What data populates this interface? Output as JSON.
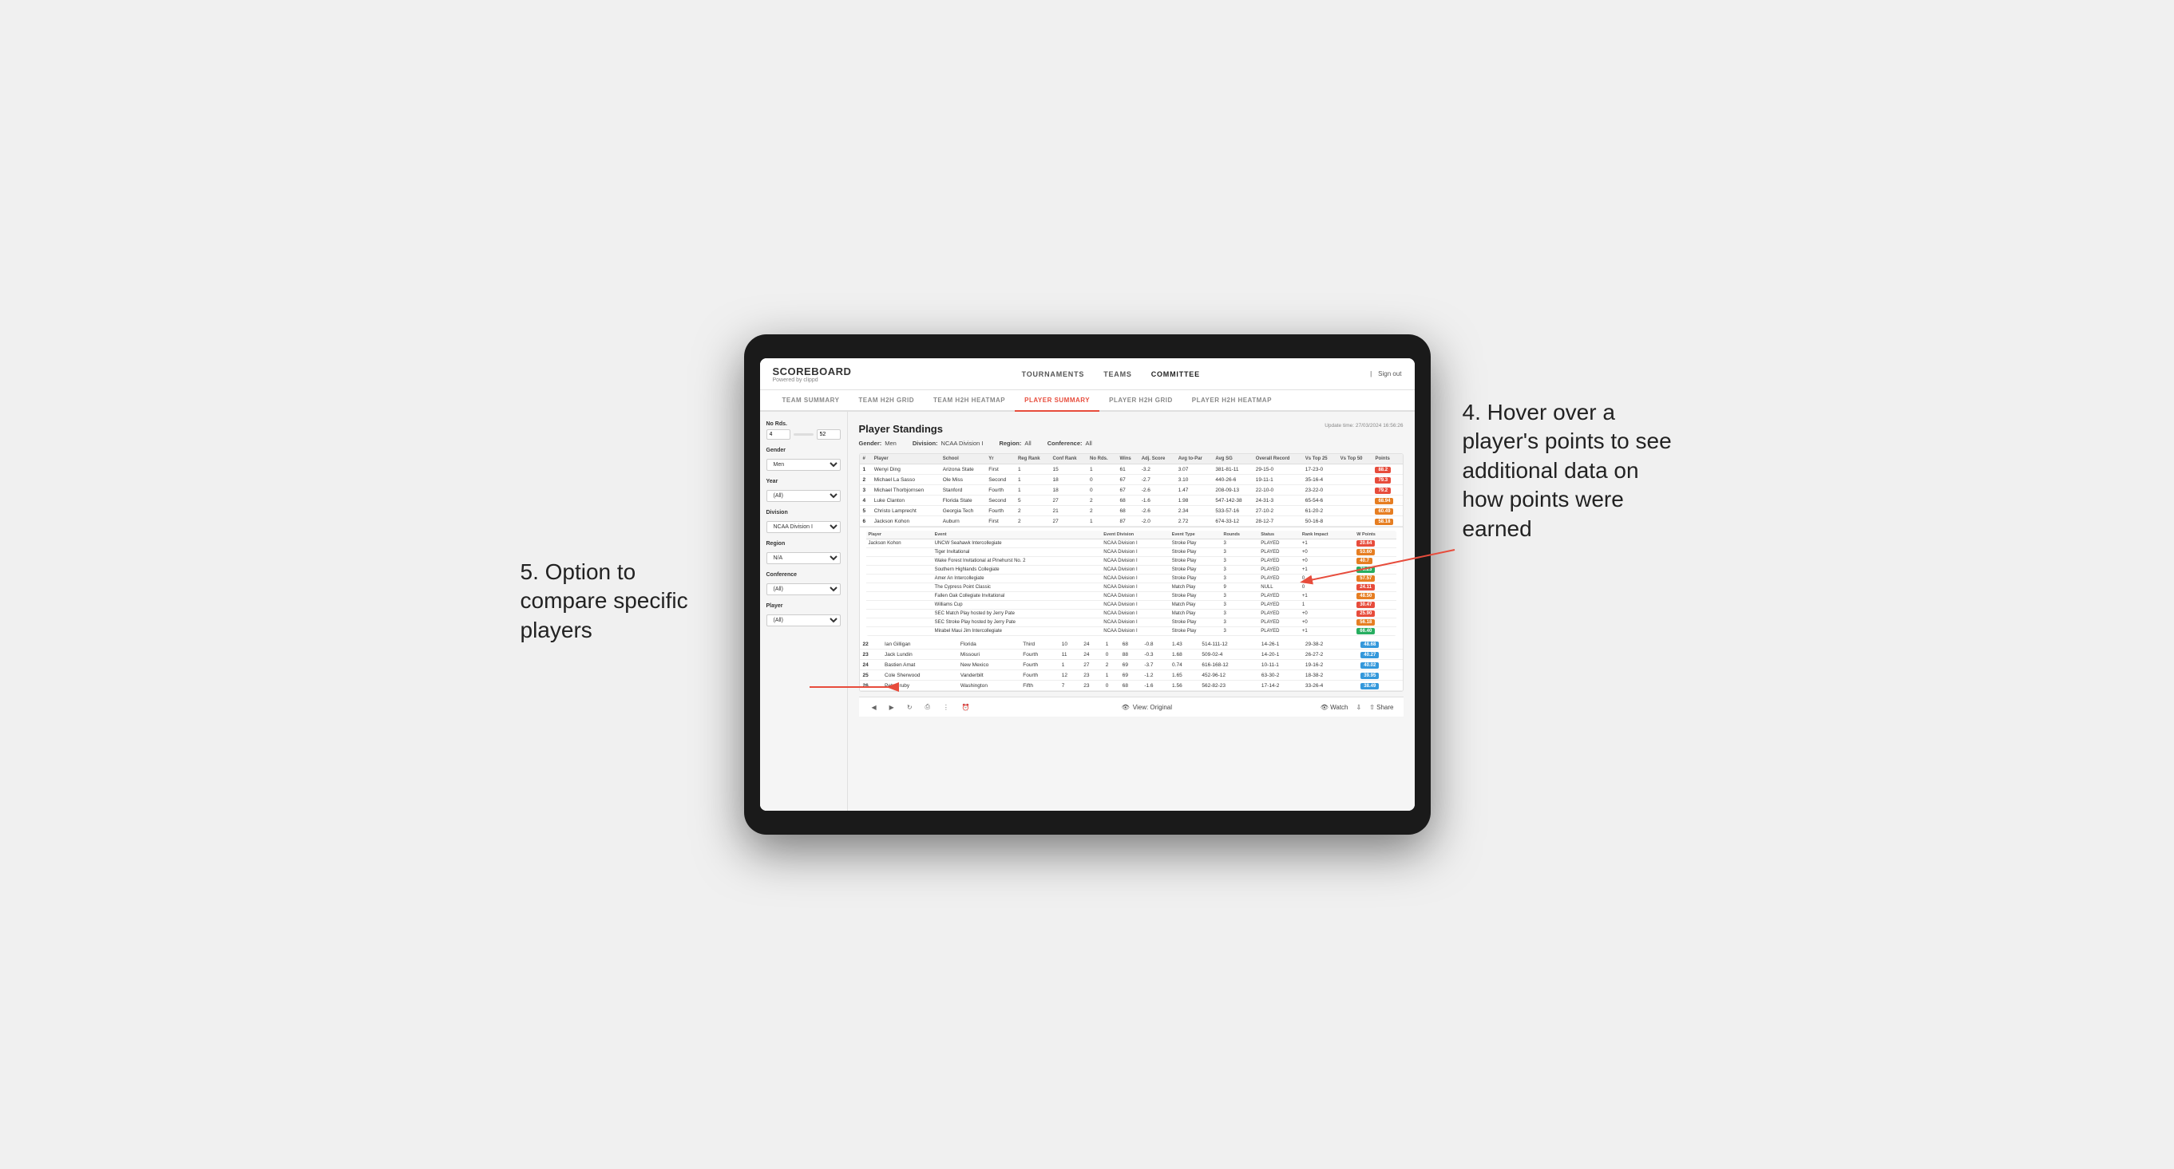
{
  "header": {
    "logo": "SCOREBOARD",
    "logo_sub": "Powered by clippd",
    "nav": [
      "TOURNAMENTS",
      "TEAMS",
      "COMMITTEE"
    ],
    "active_nav": "COMMITTEE",
    "sign_in": "Sign out"
  },
  "sub_nav": {
    "items": [
      "TEAM SUMMARY",
      "TEAM H2H GRID",
      "TEAM H2H HEATMAP",
      "PLAYER SUMMARY",
      "PLAYER H2H GRID",
      "PLAYER H2H HEATMAP"
    ],
    "active": "PLAYER SUMMARY"
  },
  "sidebar": {
    "no_rds_label": "No Rds.",
    "no_rds_min": "4",
    "no_rds_max": "52",
    "gender_label": "Gender",
    "gender_value": "Men",
    "year_label": "Year",
    "year_value": "(All)",
    "division_label": "Division",
    "division_value": "NCAA Division I",
    "region_label": "Region",
    "region_value": "N/A",
    "conference_label": "Conference",
    "conference_value": "(All)",
    "player_label": "Player",
    "player_value": "(All)"
  },
  "content": {
    "title": "Player Standings",
    "update_time": "Update time:",
    "update_date": "27/03/2024 16:56:26",
    "filters": {
      "gender": {
        "label": "Gender:",
        "value": "Men"
      },
      "division": {
        "label": "Division:",
        "value": "NCAA Division I"
      },
      "region": {
        "label": "Region:",
        "value": "All"
      },
      "conference": {
        "label": "Conference:",
        "value": "All"
      }
    }
  },
  "table": {
    "columns": [
      "#",
      "Player",
      "School",
      "Yr",
      "Reg Rank",
      "Conf Rank",
      "No Rds.",
      "Wins",
      "Adj. Score",
      "Avg to-Par",
      "Avg SG",
      "Overall Record",
      "Vs Top 25",
      "Vs Top 50",
      "Points"
    ],
    "rows": [
      {
        "rank": 1,
        "player": "Wenyi Ding",
        "school": "Arizona State",
        "yr": "First",
        "reg_rank": 1,
        "conf_rank": 15,
        "rds": 1,
        "wins": 61,
        "adj_score": "-3.2",
        "avg_to_par": "3.07",
        "avg_sg": "381-81-11",
        "overall": "29-15-0",
        "vs25": "17-23-0",
        "vs50": "",
        "points": "88.2",
        "points_color": "red"
      },
      {
        "rank": 2,
        "player": "Michael La Sasso",
        "school": "Ole Miss",
        "yr": "Second",
        "reg_rank": 1,
        "conf_rank": 18,
        "rds": 0,
        "wins": 67,
        "adj_score": "-2.7",
        "avg_to_par": "3.10",
        "avg_sg": "440-26-6",
        "overall": "19-11-1",
        "vs25": "35-16-4",
        "vs50": "",
        "points": "79.3",
        "points_color": "red"
      },
      {
        "rank": 3,
        "player": "Michael Thorbjornsen",
        "school": "Stanford",
        "yr": "Fourth",
        "reg_rank": 1,
        "conf_rank": 18,
        "rds": 0,
        "wins": 67,
        "adj_score": "-2.6",
        "avg_to_par": "1.47",
        "avg_sg": "208-09-13",
        "overall": "22-10-0",
        "vs25": "23-22-0",
        "vs50": "",
        "points": "79.2",
        "points_color": "red"
      },
      {
        "rank": 4,
        "player": "Luke Clanton",
        "school": "Florida State",
        "yr": "Second",
        "reg_rank": 5,
        "conf_rank": 27,
        "rds": 2,
        "wins": 68,
        "adj_score": "-1.6",
        "avg_to_par": "1.98",
        "avg_sg": "547-142-38",
        "overall": "24-31-3",
        "vs25": "65-54-6",
        "vs50": "",
        "points": "68.94",
        "points_color": "orange"
      },
      {
        "rank": 5,
        "player": "Christo Lamprecht",
        "school": "Georgia Tech",
        "yr": "Fourth",
        "reg_rank": 2,
        "conf_rank": 21,
        "rds": 2,
        "wins": 68,
        "adj_score": "-2.6",
        "avg_to_par": "2.34",
        "avg_sg": "533-57-16",
        "overall": "27-10-2",
        "vs25": "61-20-2",
        "vs50": "",
        "points": "60.49",
        "points_color": "orange"
      },
      {
        "rank": 6,
        "player": "Jackson Kohon",
        "school": "Auburn",
        "yr": "First",
        "reg_rank": 2,
        "conf_rank": 27,
        "rds": 1,
        "wins": 87,
        "adj_score": "-2.0",
        "avg_to_par": "2.72",
        "avg_sg": "674-33-12",
        "overall": "28-12-7",
        "vs25": "50-16-8",
        "vs50": "",
        "points": "58.18",
        "points_color": "orange"
      }
    ],
    "tooltip_rows": [
      {
        "event": "UNCW Seahawk Intercollegiate",
        "division": "NCAA Division I",
        "type": "Stroke Play",
        "rounds": 3,
        "status": "PLAYED",
        "rank_impact": "+1",
        "points": "20.64"
      },
      {
        "event": "Tiger Invitational",
        "division": "NCAA Division I",
        "type": "Stroke Play",
        "rounds": 3,
        "status": "PLAYED",
        "rank_impact": "+0",
        "points": "53.60"
      },
      {
        "event": "Wake Forest Invitational at Pinehurst No. 2",
        "division": "NCAA Division I",
        "type": "Stroke Play",
        "rounds": 3,
        "status": "PLAYED",
        "rank_impact": "+0",
        "points": "40.7"
      },
      {
        "event": "Southern Highlands Collegiate",
        "division": "NCAA Division I",
        "type": "Stroke Play",
        "rounds": 3,
        "status": "PLAYED",
        "rank_impact": "+1",
        "points": "73.23"
      },
      {
        "event": "Amer An Intercollegiate",
        "division": "NCAA Division I",
        "type": "Stroke Play",
        "rounds": 3,
        "status": "PLAYED",
        "rank_impact": "0",
        "points": "57.57"
      },
      {
        "event": "The Cypress Point Classic",
        "division": "NCAA Division I",
        "type": "Match Play",
        "rounds": 9,
        "status": "NULL",
        "rank_impact": "0",
        "points": "24.11"
      },
      {
        "event": "Fallen Oak Collegiate Invitational",
        "division": "NCAA Division I",
        "type": "Stroke Play",
        "rounds": 3,
        "status": "PLAYED",
        "rank_impact": "+1",
        "points": "48.50"
      },
      {
        "event": "Williams Cup",
        "division": "NCAA Division I",
        "type": "Match Play",
        "rounds": 3,
        "status": "PLAYED",
        "rank_impact": "1",
        "points": "30.47"
      },
      {
        "event": "SEC Match Play hosted by Jerry Pate",
        "division": "NCAA Division I",
        "type": "Match Play",
        "rounds": 3,
        "status": "PLAYED",
        "rank_impact": "+0",
        "points": "25.90"
      },
      {
        "event": "SEC Stroke Play hosted by Jerry Pate",
        "division": "NCAA Division I",
        "type": "Stroke Play",
        "rounds": 3,
        "status": "PLAYED",
        "rank_impact": "+0",
        "points": "56.18"
      },
      {
        "event": "Mirabel Maui Jim Intercollegiate",
        "division": "NCAA Division I",
        "type": "Stroke Play",
        "rounds": 3,
        "status": "PLAYED",
        "rank_impact": "+1",
        "points": "66.40"
      }
    ],
    "lower_rows": [
      {
        "rank": 22,
        "player": "Ian Gilligan",
        "school": "Florida",
        "yr": "Third",
        "reg_rank": 10,
        "conf_rank": 24,
        "rds": 1,
        "wins": 68,
        "adj_score": "-0.8",
        "avg_to_par": "1.43",
        "avg_sg": "514-111-12",
        "overall": "14-26-1",
        "vs25": "29-38-2",
        "vs50": "",
        "points": "48.68"
      },
      {
        "rank": 23,
        "player": "Jack Lundin",
        "school": "Missouri",
        "yr": "Fourth",
        "reg_rank": 11,
        "conf_rank": 24,
        "rds": 0,
        "wins": 88,
        "adj_score": "-0.3",
        "avg_to_par": "1.68",
        "avg_sg": "509-02-4",
        "overall": "14-20-1",
        "vs25": "26-27-2",
        "vs50": "",
        "points": "40.27"
      },
      {
        "rank": 24,
        "player": "Bastien Amat",
        "school": "New Mexico",
        "yr": "Fourth",
        "reg_rank": 1,
        "conf_rank": 27,
        "rds": 2,
        "wins": 69,
        "adj_score": "-3.7",
        "avg_to_par": "0.74",
        "avg_sg": "616-168-12",
        "overall": "10-11-1",
        "vs25": "19-16-2",
        "vs50": "",
        "points": "40.02"
      },
      {
        "rank": 25,
        "player": "Cole Sherwood",
        "school": "Vanderbilt",
        "yr": "Fourth",
        "reg_rank": 12,
        "conf_rank": 23,
        "rds": 1,
        "wins": 69,
        "adj_score": "-1.2",
        "avg_to_par": "1.65",
        "avg_sg": "452-96-12",
        "overall": "63-30-2",
        "vs25": "18-38-2",
        "vs50": "",
        "points": "39.95"
      },
      {
        "rank": 26,
        "player": "Petr Hruby",
        "school": "Washington",
        "yr": "Fifth",
        "reg_rank": 7,
        "conf_rank": 23,
        "rds": 0,
        "wins": 68,
        "adj_score": "-1.6",
        "avg_to_par": "1.56",
        "avg_sg": "562-82-23",
        "overall": "17-14-2",
        "vs25": "33-26-4",
        "vs50": "",
        "points": "38.49"
      }
    ]
  },
  "footer": {
    "view_original": "View: Original",
    "watch": "Watch",
    "share": "Share"
  },
  "annotations": {
    "right": "4. Hover over a player's points to see additional data on how points were earned",
    "left": "5. Option to compare specific players"
  }
}
